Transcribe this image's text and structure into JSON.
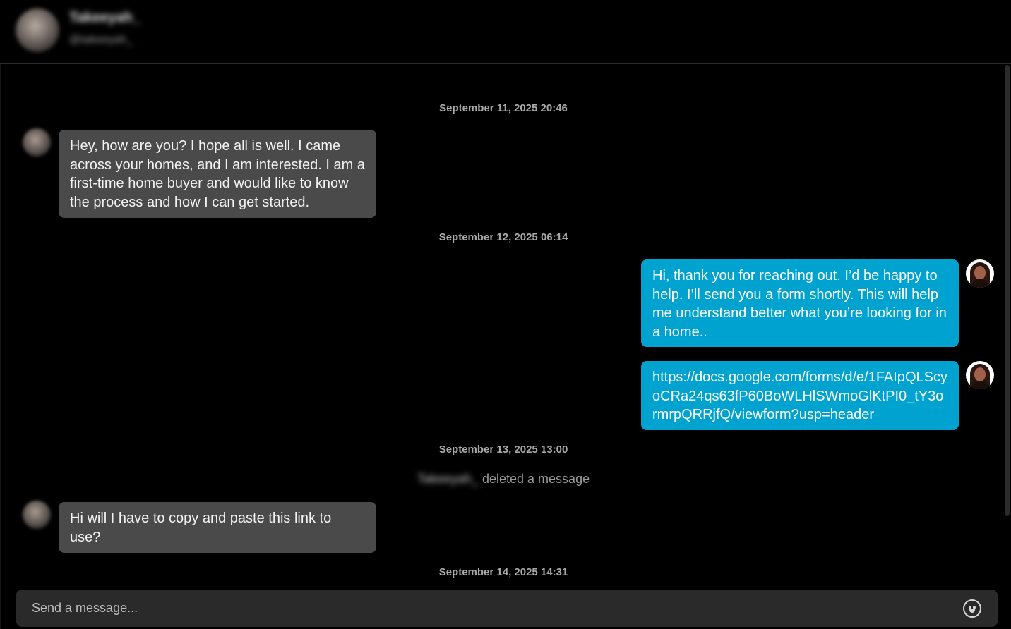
{
  "header": {
    "name": "Takeeyah_",
    "handle": "@takeeyah_"
  },
  "messages": [
    {
      "type": "timestamp",
      "text": "September 11, 2025 20:46"
    },
    {
      "type": "incoming",
      "text": "Hey, how are you? I hope all is well. I came across your homes, and I am interested. I am a first-time home buyer and would like to know the process and how I can get started."
    },
    {
      "type": "timestamp",
      "text": "September 12, 2025 06:14"
    },
    {
      "type": "outgoing",
      "text": "Hi, thank you for reaching out. I’d be happy to help. I’ll send you a form shortly. This will help me understand better what you’re looking for in a home.."
    },
    {
      "type": "outgoing",
      "text": "https://docs.google.com/forms/d/e/1FAIpQLScyoCRa24qs63fP60BoWLHlSWmoGlKtPI0_tY3ormrpQRRjfQ/viewform?usp=header"
    },
    {
      "type": "timestamp",
      "text": "September 13, 2025 13:00"
    },
    {
      "type": "system",
      "actor": "Takeeyah_",
      "text": "deleted a message"
    },
    {
      "type": "incoming",
      "text": "Hi will I have to copy and paste this link to use?"
    },
    {
      "type": "timestamp",
      "text": "September 14, 2025 14:31"
    }
  ],
  "composer": {
    "placeholder": "Send a message..."
  },
  "icons": {
    "emoji": "emoji-icon"
  },
  "colors": {
    "background": "#000000",
    "incoming_bubble": "#4a4a4a",
    "outgoing_bubble": "#00a2cf"
  }
}
